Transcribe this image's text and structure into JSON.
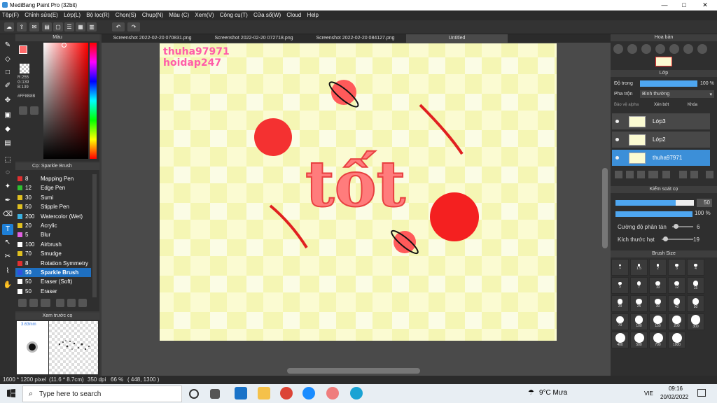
{
  "window": {
    "title": "MediBang Paint Pro (32bit)",
    "minimize": "—",
    "maximize": "□",
    "close": "✕"
  },
  "menu": [
    "Tệp(F)",
    "Chỉnh sửa(E)",
    "Lớp(L)",
    "Bộ lọc(R)",
    "Chọn(S)",
    "Chụp(N)",
    "Màu (C)",
    "Xem(V)",
    "Công cụ(T)",
    "Cửa sổ(W)",
    "Cloud",
    "Help"
  ],
  "color_panel": {
    "title": "Màu",
    "r": "R:255",
    "g": "G:139",
    "b": "B:139",
    "hex": "#FF8B8B",
    "fg": "#ff6b6b",
    "bg": "#3a7be0"
  },
  "brush_panel": {
    "title": "Cọ: Sparkle Brush",
    "items": [
      {
        "size": "8",
        "name": "Mapping Pen",
        "color": "#e03030"
      },
      {
        "size": "12",
        "name": "Edge Pen",
        "color": "#30c030"
      },
      {
        "size": "30",
        "name": "Sumi",
        "color": "#e0c020"
      },
      {
        "size": "50",
        "name": "Stipple Pen",
        "color": "#e0c020"
      },
      {
        "size": "200",
        "name": "Watercolor (Wet)",
        "color": "#3ab0e0"
      },
      {
        "size": "20",
        "name": "Acrylic",
        "color": "#e0c020"
      },
      {
        "size": "5",
        "name": "Blur",
        "color": "#e060e0"
      },
      {
        "size": "100",
        "name": "Airbrush",
        "color": "#ffffff"
      },
      {
        "size": "70",
        "name": "Smudge",
        "color": "#e0c020"
      },
      {
        "size": "8",
        "name": "Rotation Symmetry",
        "color": "#e03030"
      },
      {
        "size": "50",
        "name": "Sparkle Brush",
        "color": "#3050e0"
      },
      {
        "size": "50",
        "name": "Eraser (Soft)",
        "color": "#ffffff"
      },
      {
        "size": "50",
        "name": "Eraser",
        "color": "#ffffff"
      }
    ]
  },
  "preview_panel": {
    "title": "Xem trước cọ",
    "size": "3.63mm"
  },
  "tabs": [
    "Screenshot 2022-02-20 070831.png",
    "Screenshot 2022-02-20 072718.png",
    "Screenshot 2022-02-20 084127.png",
    "Untitled"
  ],
  "canvas": {
    "watermark1": "thuha97971",
    "watermark2": "hoidap247",
    "art_text": "tốt"
  },
  "navigator": {
    "title": "Hoa bản"
  },
  "layers": {
    "title": "Lớp",
    "opacity_label": "Độ trong",
    "opacity_value": "100 %",
    "blend_label": "Pha trộn",
    "blend_value": "Bình thường",
    "protect_alpha": "Bảo vệ alpha",
    "clipping": "Xén bớt",
    "lock": "Khóa",
    "items": [
      {
        "name": "Lớp3",
        "selected": false
      },
      {
        "name": "Lớp2",
        "selected": false
      },
      {
        "name": "thuha97971",
        "selected": true
      }
    ]
  },
  "brush_control": {
    "title": "Kiểm soát cọ",
    "size": "50",
    "opacity": "100 %",
    "scatter_label": "Cường độ phân tán",
    "scatter_value": "6",
    "particle_label": "Kích thước hạt",
    "particle_value": "19"
  },
  "brush_size": {
    "title": "Brush Size",
    "sizes": [
      "1",
      "1.5",
      "2",
      "3",
      "4",
      "5",
      "7",
      "10",
      "12",
      "15",
      "20",
      "25",
      "30",
      "40",
      "50",
      "70",
      "100",
      "150",
      "200",
      "300",
      "400",
      "500",
      "700",
      "1000"
    ]
  },
  "status": {
    "dims": "1600 * 1200 pixel",
    "cm": "(11.6 * 8.7cm)",
    "dpi": "350 dpi",
    "zoom": "66 %",
    "coords": "( 448, 1300 )"
  },
  "taskbar": {
    "search_placeholder": "Type here to search",
    "weather": "9°C  Mưa",
    "lang": "VIE",
    "time": "09:16",
    "date": "20/02/2022"
  }
}
